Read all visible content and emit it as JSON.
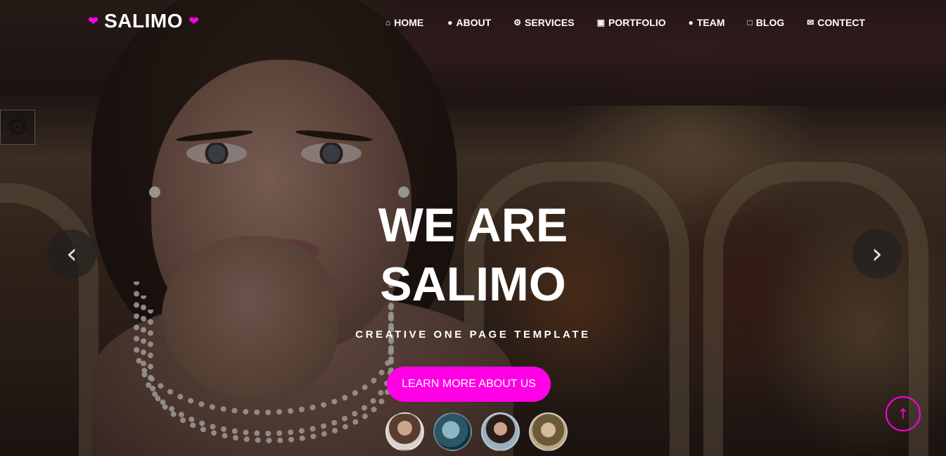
{
  "brand": {
    "name": "SALIMO",
    "left_heart_icon": "heart-icon",
    "right_heart_icon": "heart-icon",
    "accent_color": "#ff00e6"
  },
  "nav": {
    "items": [
      {
        "label": "HOME",
        "icon": "home-icon"
      },
      {
        "label": "ABOUT",
        "icon": "user-icon"
      },
      {
        "label": "SERVICES",
        "icon": "gear-icon"
      },
      {
        "label": "PORTFOLIO",
        "icon": "image-icon"
      },
      {
        "label": "TEAM",
        "icon": "user-icon"
      },
      {
        "label": "BLOG",
        "icon": "chat-icon"
      },
      {
        "label": "CONTECT",
        "icon": "envelope-icon"
      }
    ]
  },
  "hero": {
    "headline_line1": "WE ARE",
    "headline_line2": "SALIMO",
    "tagline": "CREATIVE ONE PAGE TEMPLATE",
    "cta_label": "LEARN MORE ABOUT US",
    "thumbnails": [
      "slide-1",
      "slide-2",
      "slide-3",
      "slide-4"
    ]
  },
  "controls": {
    "settings_icon": "gear-icon",
    "prev_icon": "chevron-left-icon",
    "next_icon": "chevron-right-icon",
    "back_to_top_icon": "arrow-up-icon"
  }
}
